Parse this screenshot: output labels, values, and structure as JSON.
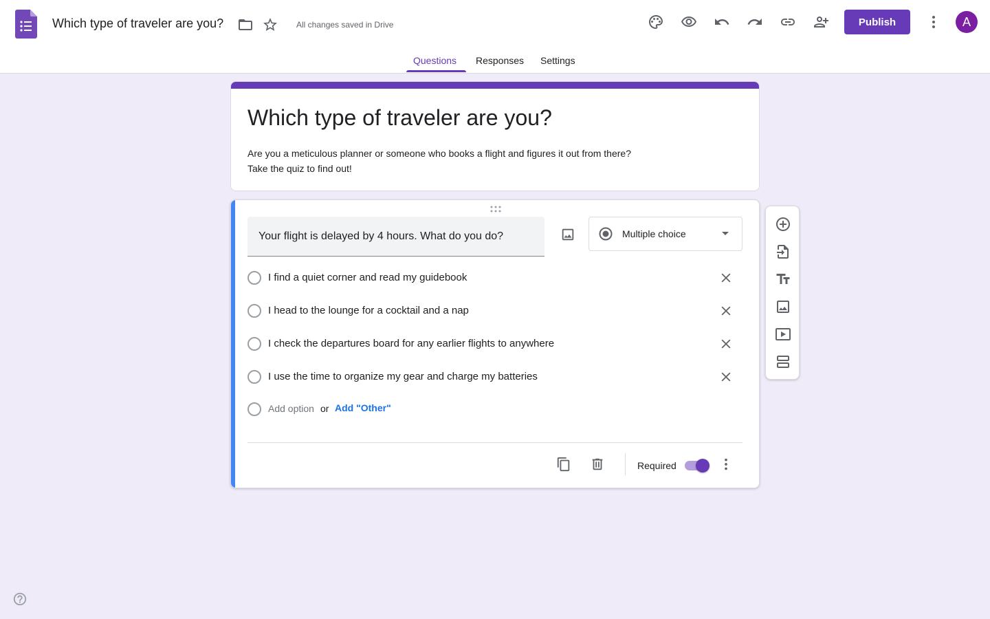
{
  "header": {
    "doc_title": "Which type of traveler are you?",
    "saved_status": "All changes saved in Drive",
    "publish_label": "Publish",
    "avatar_initial": "A",
    "icons": [
      "forms-logo-icon",
      "folder-icon",
      "star-icon",
      "palette-icon",
      "eye-icon",
      "undo-icon",
      "redo-icon",
      "link-icon",
      "add-person-icon",
      "more-vert-icon"
    ]
  },
  "tabs": [
    {
      "label": "Questions",
      "active": true
    },
    {
      "label": "Responses",
      "active": false
    },
    {
      "label": "Settings",
      "active": false
    }
  ],
  "form": {
    "title": "Which type of traveler are you?",
    "description_line1": "Are you a meticulous planner or someone who books a flight and figures it out from there?",
    "description_line2": "Take the quiz to find out!"
  },
  "question": {
    "text": "Your flight is delayed by 4 hours. What do you do?",
    "type": "Multiple choice",
    "options": [
      "I find a quiet corner and read my guidebook",
      "I head to the lounge for a cocktail and a nap",
      "I check the departures board for any earlier flights to anywhere",
      "I use the time to organize my gear and charge my batteries"
    ],
    "add_option_label": "Add option",
    "or_label": "or",
    "add_other_label": "Add \"Other\"",
    "required_label": "Required",
    "required": true
  },
  "colors": {
    "brand": "#673ab7",
    "accent_blue": "#4285f4",
    "background": "#f0ebf8",
    "link": "#1a73e8"
  }
}
